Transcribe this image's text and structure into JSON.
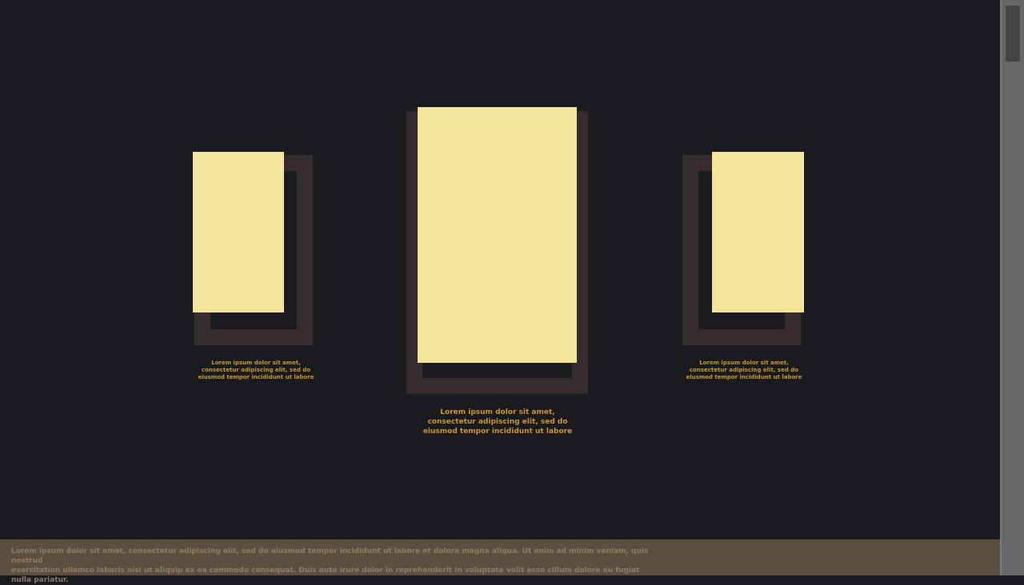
{
  "gallery": {
    "left": {
      "caption_line1": "Lorem ipsum dolor sit amet,",
      "caption_line2": "consectetur adipiscing elit, sed do",
      "caption_line3": "eiusmod tempor incididunt ut labore"
    },
    "center": {
      "caption_line1": "Lorem ipsum dolor sit amet,",
      "caption_line2": "consectetur adipiscing elit, sed do",
      "caption_line3": "eiusmod tempor incididunt ut labore"
    },
    "right": {
      "caption_line1": "Lorem ipsum dolor sit amet,",
      "caption_line2": "consectetur adipiscing elit, sed do",
      "caption_line3": "eiusmod tempor incididunt ut labore"
    }
  },
  "footer": {
    "line1": "Lorem ipsum dolor sit amet, consectetur adipiscing elit, sed do eiusmod tempor incididunt ut labore et dolore magna aliqua. Ut enim ad minim veniam, quis nostrud",
    "line2": "exercitation ullamco laboris nisi ut aliquip ex ea commodo consequat. Duis aute irure dolor in reprehenderit in voluptate velit esse cillum dolore eu fugiat nulla pariatur."
  },
  "colors": {
    "background": "#1a1b1f",
    "frame": "#362c2e",
    "card": "#f5e59a",
    "caption": "#c9962f",
    "footer_bg": "#5d4f40",
    "footer_text": "#8f7c62",
    "scrollbar_track": "#676767",
    "scrollbar_thumb": "#444444"
  }
}
